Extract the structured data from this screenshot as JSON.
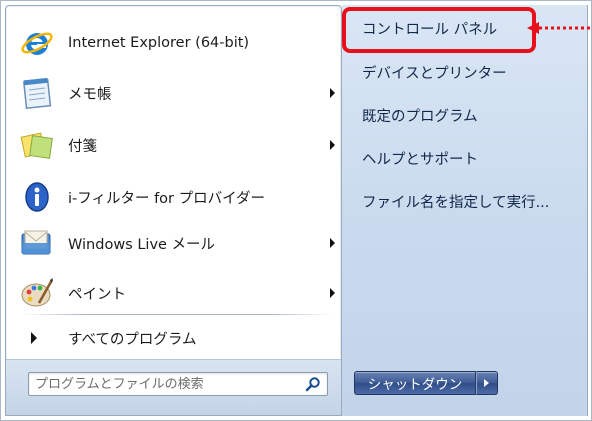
{
  "accent": "#e8101a",
  "left_pane": {
    "programs": [
      {
        "label": "Internet Explorer (64-bit)",
        "icon": "internet-explorer-icon",
        "submenu": false
      },
      {
        "label": "メモ帳",
        "icon": "notepad-icon",
        "submenu": true
      },
      {
        "label": "付箋",
        "icon": "sticky-notes-icon",
        "submenu": true
      },
      {
        "label": "i-フィルター for プロバイダー",
        "icon": "i-filter-icon",
        "submenu": false
      },
      {
        "label": "Windows Live メール",
        "icon": "windows-live-mail-icon",
        "submenu": true
      },
      {
        "label": "ペイント",
        "icon": "paint-icon",
        "submenu": true
      }
    ],
    "all_programs_label": "すべてのプログラム"
  },
  "search": {
    "placeholder": "プログラムとファイルの検索",
    "icon": "search-icon"
  },
  "right_pane": {
    "links": [
      "コントロール パネル",
      "デバイスとプリンター",
      "既定のプログラム",
      "ヘルプとサポート",
      "ファイル名を指定して実行..."
    ],
    "highlighted_index": 0
  },
  "shutdown": {
    "label": "シャットダウン",
    "options_icon": "chevron-right-icon"
  }
}
